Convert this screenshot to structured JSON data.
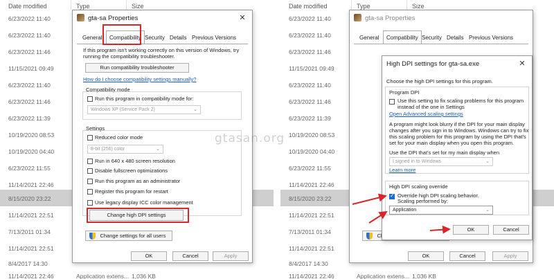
{
  "explorer": {
    "headers": {
      "date_modified": "Date modified",
      "type": "Type",
      "size": "Size"
    },
    "rows": [
      {
        "date": "6/23/2022 11:40"
      },
      {
        "date": "6/23/2022 11:40"
      },
      {
        "date": "6/23/2022 11:46"
      },
      {
        "date": "11/15/2021 09:49"
      },
      {
        "date": "6/23/2022 11:40"
      },
      {
        "date": "6/23/2022 11:46"
      },
      {
        "date": "6/23/2022 11:39"
      },
      {
        "date": "10/19/2020 08:53"
      },
      {
        "date": "10/19/2020 04:40"
      },
      {
        "date": "6/23/2022 11:55"
      },
      {
        "date": "11/14/2021 22:46"
      },
      {
        "date": "8/15/2020 23:22"
      },
      {
        "date": "11/14/2021 22:51"
      },
      {
        "date": "7/13/2011 01:34"
      },
      {
        "date": "11/14/2021 22:51"
      },
      {
        "date": "8/4/2017 14:30"
      },
      {
        "date": "11/14/2021 22:46",
        "type": "Application extens...",
        "size": "1,036 KB"
      }
    ]
  },
  "properties": {
    "title": "gta-sa Properties",
    "tabs": [
      "General",
      "Compatibility",
      "Security",
      "Details",
      "Previous Versions"
    ],
    "intro_line1": "If this program isn't working correctly on this version of Windows, try",
    "intro_line2": "running the compatibility troubleshooter.",
    "troubleshooter_button": "Run compatibility troubleshooter",
    "manual_link": "How do I choose compatibility settings manually?",
    "compat_mode_group": "Compatibility mode",
    "compat_mode_checkbox": "Run this program in compatibility mode for:",
    "compat_mode_select": "Windows XP (Service Pack 2)",
    "settings_group": "Settings",
    "reduced_color": "Reduced color mode",
    "color_select": "8-bit (256) color",
    "run_640": "Run in 640 x 480 screen resolution",
    "disable_fullscreen": "Disable fullscreen optimizations",
    "run_admin": "Run this program as an administrator",
    "register_restart": "Register this program for restart",
    "legacy_icc": "Use legacy display ICC color management",
    "change_dpi_button": "Change high DPI settings",
    "change_all_users_button": "Change settings for all users",
    "ok": "OK",
    "cancel": "Cancel",
    "apply": "Apply"
  },
  "dpi_dialog": {
    "title": "High DPI settings for gta-sa.exe",
    "subtitle": "Choose the high DPI settings for this program.",
    "program_dpi_group": "Program DPI",
    "program_dpi_checkbox_line1": "Use this setting to fix scaling problems for this program",
    "program_dpi_checkbox_line2": "instead of the one in Settings",
    "advanced_link": "Open Advanced scaling settings",
    "para_line1": "A program might look blurry if the DPI for your main display",
    "para_line2": "changes after you sign in to Windows. Windows can try to fix",
    "para_line3": "this scaling problem for this program by using the DPI that's",
    "para_line4": "set for your main display when you open this program.",
    "use_dpi_label": "Use the DPI that's set for my main display when",
    "signed_in_select": "I signed in to Windows",
    "learn_more": "Learn more",
    "override_group": "High DPI scaling override",
    "override_line1": "Override high DPI scaling behavior.",
    "override_line2": "Scaling performed by:",
    "scaling_select": "Application",
    "ok": "OK",
    "cancel": "Cancel"
  },
  "watermark": "gtasan.org",
  "colors": {
    "highlight_red": "#d8262b",
    "accent_blue": "#1a6dcc",
    "link_blue": "#1a5fb4"
  }
}
